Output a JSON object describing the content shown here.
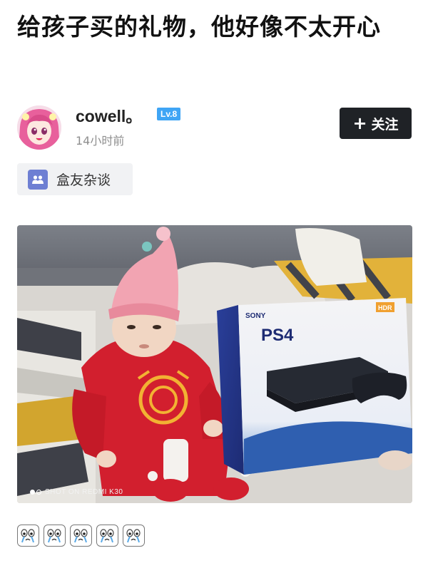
{
  "post": {
    "title": "给孩子买的礼物，他好像不太开心",
    "author": {
      "name": "cowell。",
      "level": "Lv.8",
      "time": "14小时前"
    },
    "follow_label": "关注",
    "follow_symbol": "+",
    "tag": "盒友杂谈",
    "image": {
      "watermark": "SHOT ON REDMI K30",
      "box_brand": "SONY",
      "box_product": "PS4",
      "box_badge": "HDR"
    },
    "reaction_emojis": [
      "crying-face-icon",
      "crying-face-icon",
      "crying-face-icon",
      "crying-face-icon",
      "crying-face-icon"
    ]
  },
  "colors": {
    "follow_button_bg": "#1f2226",
    "level_badge_bg": "#3fa5f5",
    "tag_bg": "#f1f2f4",
    "tag_icon_bg": "#6e7fd3"
  }
}
